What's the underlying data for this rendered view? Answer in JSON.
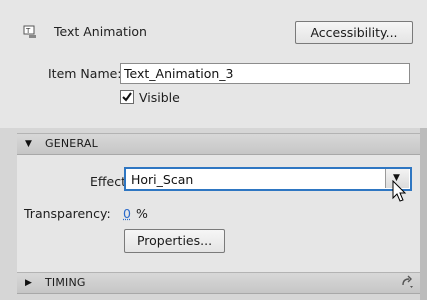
{
  "header": {
    "title": "Text Animation",
    "accessibility_label": "Accessibility...",
    "item_name_label": "Item Name:",
    "item_name_value": "Text_Animation_3",
    "visible_label": "Visible",
    "visible_checked": true,
    "icon": "text-animation-icon"
  },
  "general": {
    "title": "GENERAL",
    "expanded": true,
    "effect_label": "Effect:",
    "effect_value": "Hori_Scan",
    "transparency_label": "Transparency:",
    "transparency_value": "0",
    "transparency_unit": "%",
    "properties_label": "Properties..."
  },
  "timing": {
    "title": "TIMING",
    "expanded": false,
    "tool_icon": "reset-icon"
  },
  "colors": {
    "focus_border": "#2e76c2",
    "link_value": "#2a6acb"
  }
}
